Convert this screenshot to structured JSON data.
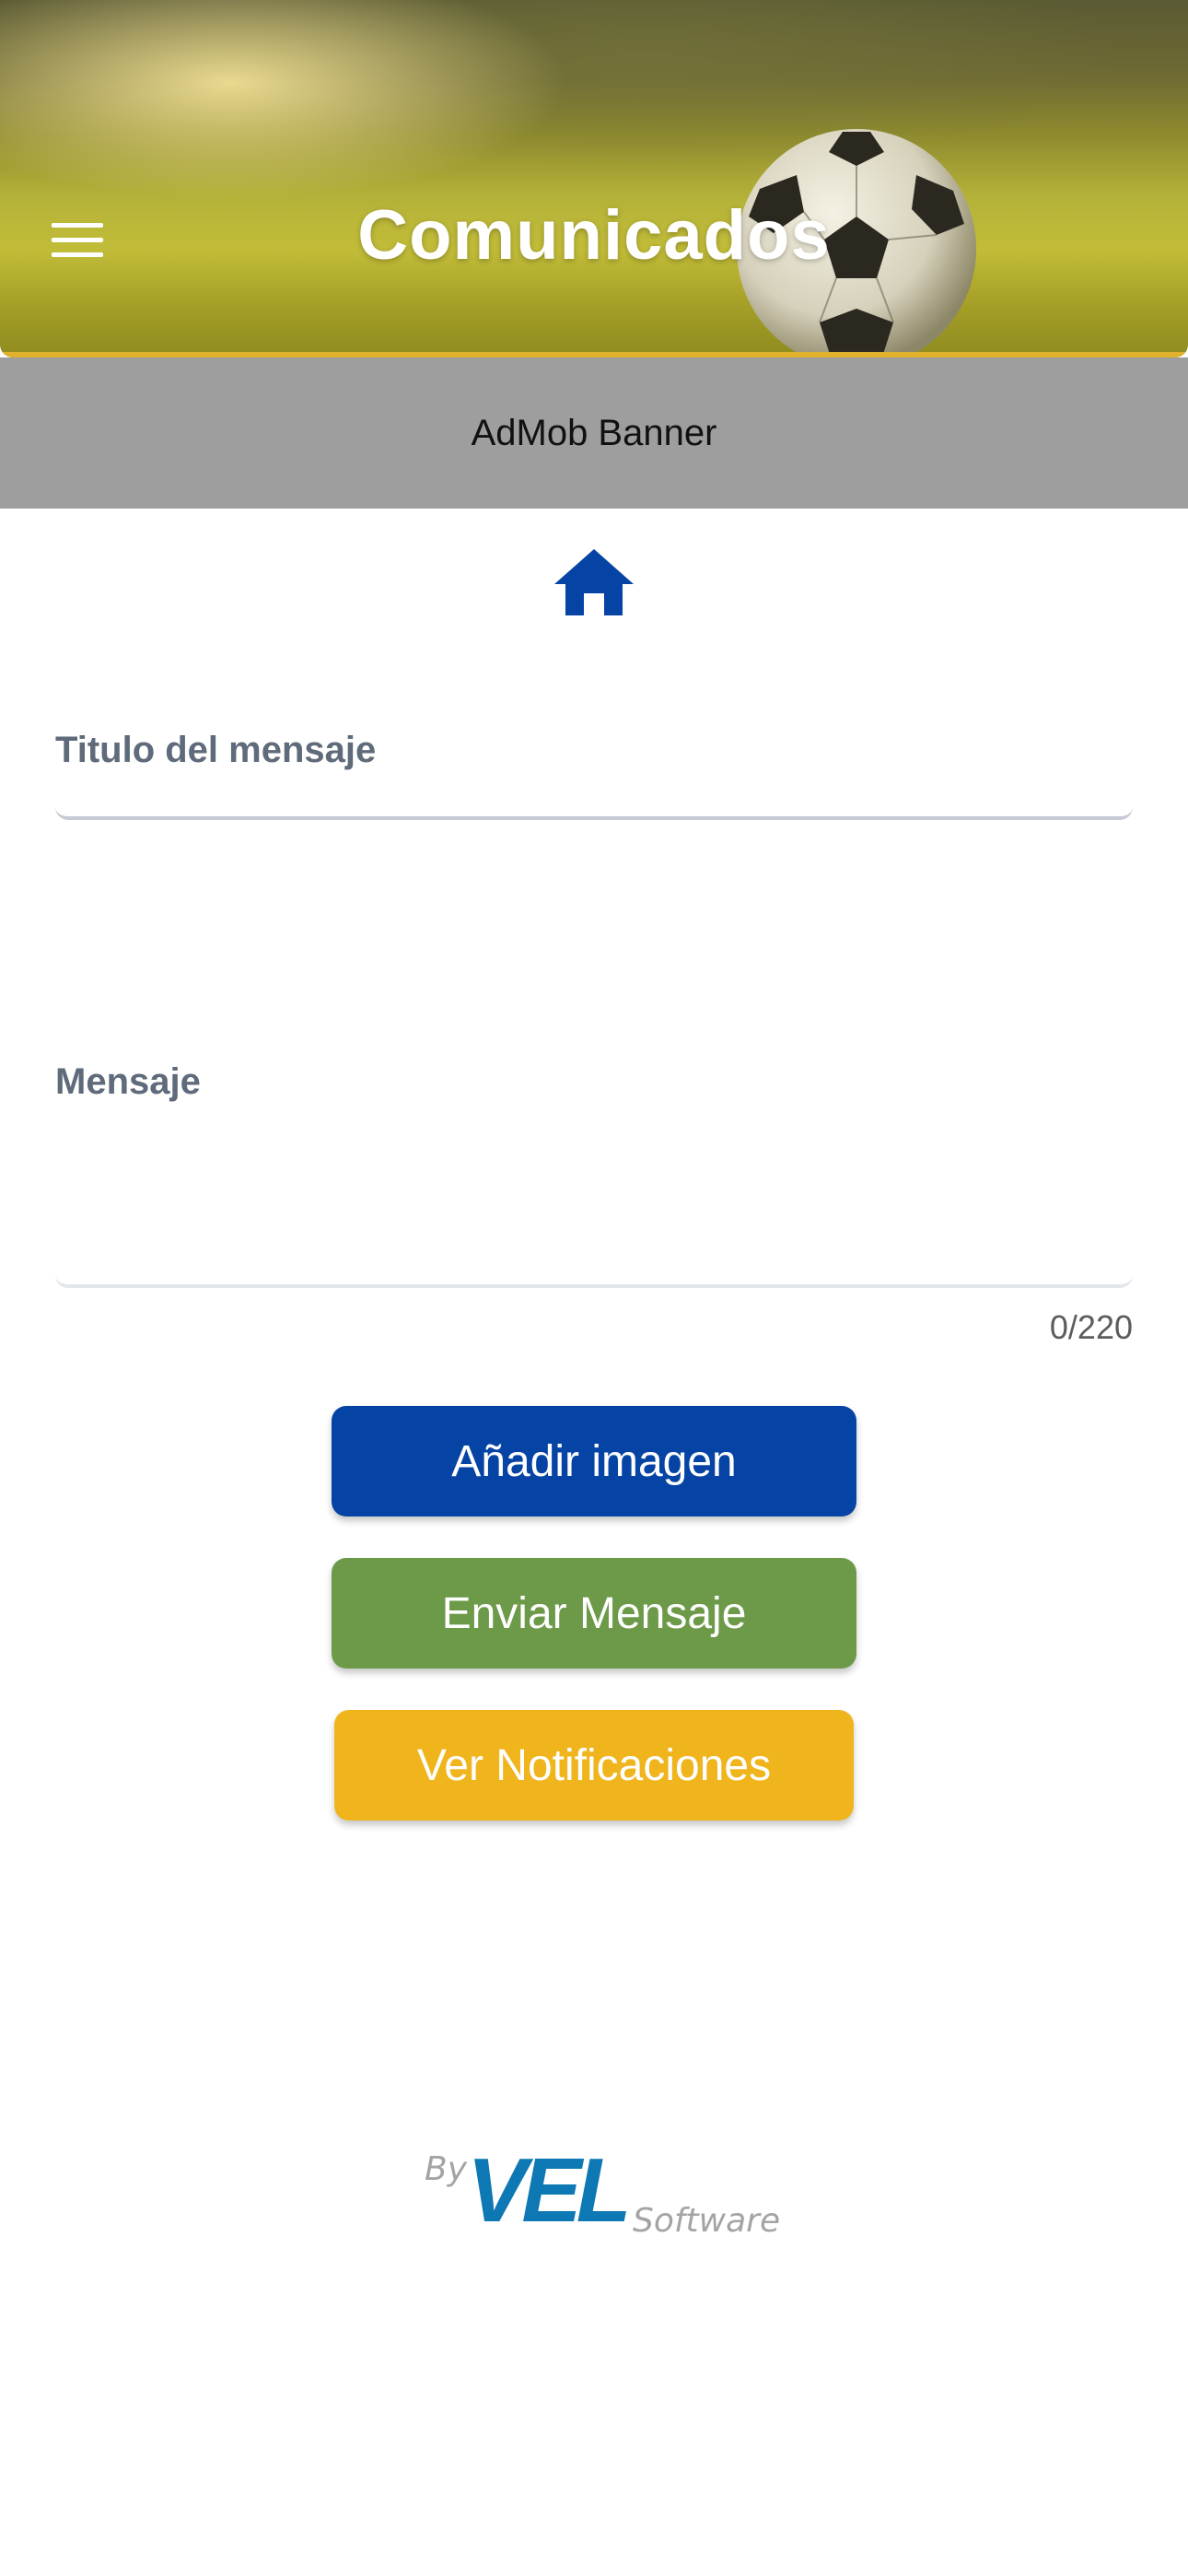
{
  "header": {
    "title": "Comunicados",
    "menu_icon": "hamburger-menu-icon"
  },
  "ad_banner": {
    "label": "AdMob Banner"
  },
  "home_icon": "home-icon",
  "form": {
    "title_field": {
      "placeholder": "Titulo del mensaje",
      "value": ""
    },
    "message_field": {
      "placeholder": "Mensaje",
      "value": "",
      "counter": "0/220"
    }
  },
  "buttons": {
    "add_image": "Añadir imagen",
    "send_message": "Enviar Mensaje",
    "view_notifications": "Ver Notificaciones"
  },
  "footer": {
    "by": "By",
    "brand": "VEL",
    "software": "Software"
  },
  "colors": {
    "primary_blue": "#0544a4",
    "send_green": "#6c9a48",
    "notif_yellow": "#f0b41c",
    "ad_gray": "#9e9e9e",
    "brand_blue": "#0d78b3"
  }
}
